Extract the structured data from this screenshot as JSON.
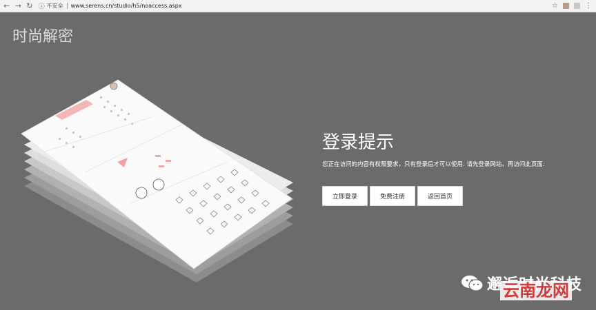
{
  "browser": {
    "security_label": "不安全",
    "url": "www.serens.cn/studio/h5/noaccess.aspx"
  },
  "page": {
    "logo_text": "时尚解密",
    "title": "登录提示",
    "description": "您正在访问的内容有权限要求，只有登录后才可以使用. 请先登录网站，再访问此页面.",
    "buttons": {
      "login": "立即登录",
      "register": "免费注册",
      "home": "返回首页"
    }
  },
  "overlay": {
    "wechat_account": "邂逅时尚科技",
    "watermark": "云南龙网"
  },
  "colors": {
    "background": "#6b6b6b",
    "button_bg": "#ffffff",
    "watermark": "#d23a3a"
  }
}
